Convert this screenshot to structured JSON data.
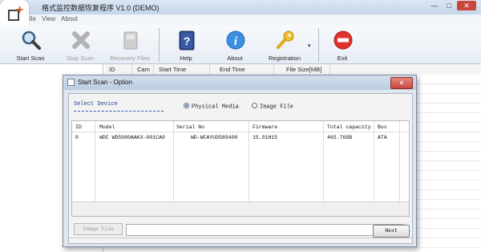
{
  "window": {
    "title": "格式监控数据恢复程序 V1.0 (DEMO)",
    "controls": [
      "—",
      "□",
      "✕"
    ]
  },
  "menu": {
    "items": [
      "File",
      "View",
      "About"
    ]
  },
  "toolbar": {
    "buttons": [
      {
        "label": "Start Scan",
        "icon": "magnifier-icon",
        "enabled": true
      },
      {
        "label": "Stop Scan",
        "icon": "stop-x-icon",
        "enabled": false
      },
      {
        "label": "Recovery Files",
        "icon": "recovery-disk-icon",
        "enabled": false
      },
      {
        "label": "Help",
        "icon": "help-book-icon",
        "enabled": true
      },
      {
        "label": "About",
        "icon": "info-icon",
        "enabled": true
      },
      {
        "label": "Registration",
        "icon": "key-icon",
        "enabled": true
      },
      {
        "label": "Exit",
        "icon": "exit-icon",
        "enabled": true
      }
    ]
  },
  "file_list": {
    "columns": [
      "ID",
      "Cam",
      "Start Time",
      "End Time",
      "File Size[MB]"
    ]
  },
  "dialog": {
    "title": "Start Scan - Option",
    "close_label": "✕",
    "select_device_label": "Select Device",
    "radio_physical": "Physical Media",
    "radio_image": "Image File",
    "selected_source": "Physical Media",
    "table": {
      "columns": [
        "ID",
        "Model",
        "Serial No",
        "Firmware",
        "Total capacity",
        "Bus"
      ],
      "rows": [
        [
          "0",
          "WDC WD5000AAKX-001CA0",
          "WD-WCAYUD589400",
          "15.01H15",
          "465.76GB",
          "ATA"
        ]
      ]
    },
    "image_file_button": "Image File",
    "image_file_path": "",
    "next_button": "Next"
  },
  "colors": {
    "titlebar": "#c6d6ea",
    "dialog_bg": "#dfe6ee",
    "close_red": "#c8463c",
    "select_device_blue": "#2a3f8f"
  }
}
